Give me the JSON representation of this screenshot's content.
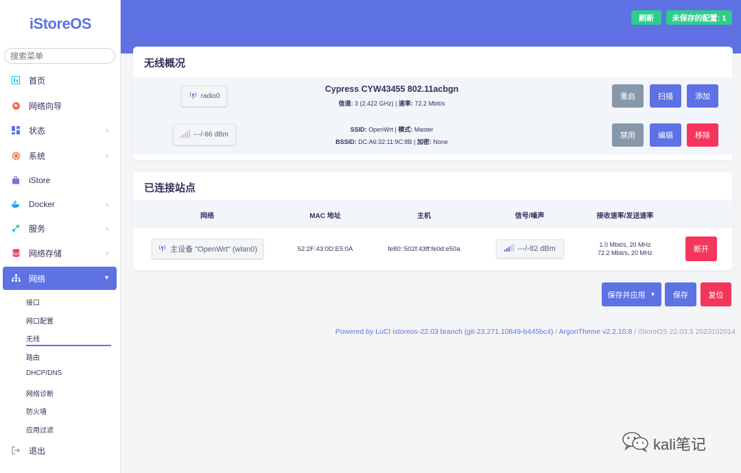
{
  "sidebar": {
    "logo": "iStoreOS",
    "search_placeholder": "搜索菜单",
    "items": [
      {
        "label": "首页"
      },
      {
        "label": "网络向导"
      },
      {
        "label": "状态"
      },
      {
        "label": "系统"
      },
      {
        "label": "iStore"
      },
      {
        "label": "Docker"
      },
      {
        "label": "服务"
      },
      {
        "label": "网络存储"
      },
      {
        "label": "网络"
      },
      {
        "label": "退出"
      }
    ],
    "sub_items": [
      {
        "label": "接口"
      },
      {
        "label": "网口配置"
      },
      {
        "label": "无线"
      },
      {
        "label": "路由"
      },
      {
        "label": "DHCP/DNS"
      },
      {
        "label": "网络诊断"
      },
      {
        "label": "防火墙"
      },
      {
        "label": "应用过滤"
      }
    ]
  },
  "header": {
    "refresh_label": "刷新",
    "unsaved_label": "未保存的配置: 1"
  },
  "overview": {
    "title": "无线概况",
    "radio": {
      "chip_label": "radio0",
      "name": "Cypress CYW43455 802.11acbgn",
      "channel_label": "信道:",
      "channel_value": "3 (2.422 GHz)",
      "rate_label": "速率:",
      "rate_value": "72.2 Mbit/s",
      "buttons": {
        "restart": "重启",
        "scan": "扫描",
        "add": "添加"
      }
    },
    "iface": {
      "signal_chip": "---/-86 dBm",
      "ssid_label": "SSID:",
      "ssid_value": "OpenWrt",
      "mode_label": "模式:",
      "mode_value": "Master",
      "bssid_label": "BSSID:",
      "bssid_value": "DC:A6:32:11:9C:8B",
      "encryption_label": "加密:",
      "encryption_value": "None",
      "buttons": {
        "disable": "禁用",
        "edit": "编辑",
        "remove": "移除"
      }
    }
  },
  "stations": {
    "title": "已连接站点",
    "columns": [
      "网络",
      "MAC 地址",
      "主机",
      "信号/噪声",
      "接收速率/发送速率"
    ],
    "rows": [
      {
        "network": "主设备 \"OpenWrt\" (wlan0)",
        "mac": "52:2F:43:0D:E5:0A",
        "host": "fe80::502f:43ff:fe0d:e50a",
        "signal": "---/-82 dBm",
        "rx_rate": "1.0 Mbit/s, 20 MHz",
        "tx_rate": "72.2 Mbit/s, 20 MHz",
        "action": "断开"
      }
    ]
  },
  "actions": {
    "save_apply": "保存并应用",
    "save": "保存",
    "reset": "复位"
  },
  "footer": {
    "powered": "Powered by LuCI istoreos-22.03 branch (git-23.271.10849-b445bc4)",
    "sep1": " / ",
    "theme": "ArgonTheme v2.2.10.8",
    "sep2": " / ",
    "version": "iStoreOS 22.03.5 2023102014"
  },
  "watermark": {
    "text": "kali笔记"
  },
  "colors": {
    "accent": "#5e72e4",
    "success": "#2dce89",
    "danger": "#f5365c",
    "neutral": "#8898aa"
  }
}
